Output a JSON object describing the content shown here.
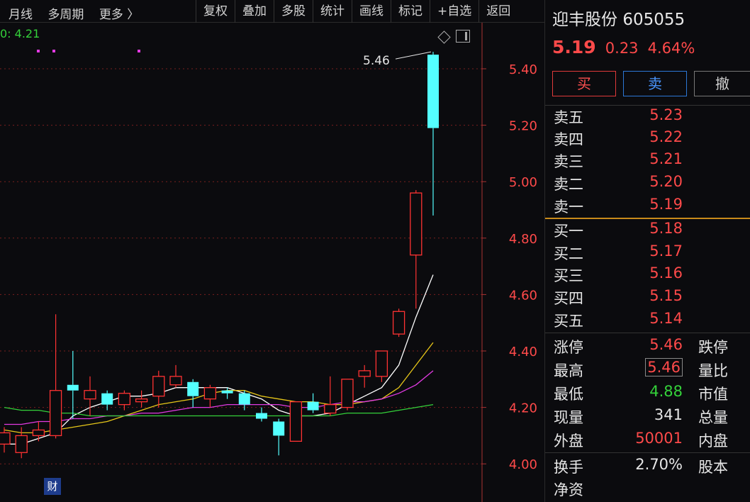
{
  "toolbar": {
    "left": [
      "月线",
      "多周期",
      "更多 〉"
    ],
    "right": [
      "复权",
      "叠加",
      "多股",
      "统计",
      "画线",
      "标记",
      "+自选",
      "返回"
    ]
  },
  "chart": {
    "ma_label": "0: 4.21",
    "high_label": "5.46",
    "cai_badge": "财",
    "y_ticks": [
      "5.40",
      "5.20",
      "5.00",
      "4.80",
      "4.60",
      "4.40",
      "4.20",
      "4.00"
    ],
    "up_color": "#ff3232",
    "down_color": "#54ffff"
  },
  "chart_data": {
    "type": "candlestick",
    "y_ticks": [
      5.4,
      5.2,
      5.0,
      4.8,
      4.6,
      4.4,
      4.2,
      4.0
    ],
    "candles": [
      {
        "o": 4.07,
        "c": 4.11,
        "h": 4.13,
        "l": 4.04
      },
      {
        "o": 4.04,
        "c": 4.1,
        "h": 4.13,
        "l": 4.02
      },
      {
        "o": 4.1,
        "c": 4.12,
        "h": 4.15,
        "l": 4.08
      },
      {
        "o": 4.1,
        "c": 4.26,
        "h": 4.53,
        "l": 4.09
      },
      {
        "o": 4.28,
        "c": 4.26,
        "h": 4.4,
        "l": 4.16
      },
      {
        "o": 4.23,
        "c": 4.26,
        "h": 4.31,
        "l": 4.17
      },
      {
        "o": 4.25,
        "c": 4.21,
        "h": 4.26,
        "l": 4.19
      },
      {
        "o": 4.21,
        "c": 4.25,
        "h": 4.26,
        "l": 4.19
      },
      {
        "o": 4.22,
        "c": 4.23,
        "h": 4.26,
        "l": 4.2
      },
      {
        "o": 4.24,
        "c": 4.31,
        "h": 4.33,
        "l": 4.2
      },
      {
        "o": 4.28,
        "c": 4.31,
        "h": 4.35,
        "l": 4.27
      },
      {
        "o": 4.29,
        "c": 4.24,
        "h": 4.3,
        "l": 4.2
      },
      {
        "o": 4.23,
        "c": 4.27,
        "h": 4.28,
        "l": 4.2
      },
      {
        "o": 4.26,
        "c": 4.25,
        "h": 4.27,
        "l": 4.23
      },
      {
        "o": 4.25,
        "c": 4.21,
        "h": 4.26,
        "l": 4.19
      },
      {
        "o": 4.18,
        "c": 4.16,
        "h": 4.2,
        "l": 4.15
      },
      {
        "o": 4.15,
        "c": 4.1,
        "h": 4.16,
        "l": 4.03
      },
      {
        "o": 4.08,
        "c": 4.22,
        "h": 4.22,
        "l": 4.08
      },
      {
        "o": 4.22,
        "c": 4.19,
        "h": 4.25,
        "l": 4.18
      },
      {
        "o": 4.18,
        "c": 4.21,
        "h": 4.31,
        "l": 4.17
      },
      {
        "o": 4.2,
        "c": 4.3,
        "h": 4.3,
        "l": 4.19
      },
      {
        "o": 4.31,
        "c": 4.33,
        "h": 4.35,
        "l": 4.27
      },
      {
        "o": 4.31,
        "c": 4.4,
        "h": 4.4,
        "l": 4.29
      },
      {
        "o": 4.46,
        "c": 4.54,
        "h": 4.55,
        "l": 4.45
      },
      {
        "o": 4.74,
        "c": 4.96,
        "h": 4.97,
        "l": 4.55
      },
      {
        "o": 5.45,
        "c": 5.19,
        "h": 5.46,
        "l": 4.88
      }
    ],
    "ma_lines": [
      {
        "color": "#ffffff",
        "values": [
          4.07,
          4.07,
          4.09,
          4.11,
          4.17,
          4.2,
          4.22,
          4.24,
          4.24,
          4.25,
          4.27,
          4.27,
          4.27,
          4.27,
          4.25,
          4.23,
          4.19,
          4.17,
          4.17,
          4.18,
          4.21,
          4.24,
          4.27,
          4.35,
          4.52,
          4.67
        ]
      },
      {
        "color": "#e6c619",
        "values": [
          4.12,
          4.11,
          4.11,
          4.12,
          4.13,
          4.14,
          4.15,
          4.17,
          4.19,
          4.21,
          4.22,
          4.23,
          4.25,
          4.26,
          4.26,
          4.24,
          4.23,
          4.22,
          4.22,
          4.21,
          4.21,
          4.22,
          4.23,
          4.27,
          4.35,
          4.43
        ]
      },
      {
        "color": "#e23ae2",
        "values": [
          4.14,
          4.14,
          4.15,
          4.15,
          4.16,
          4.16,
          4.17,
          4.17,
          4.18,
          4.18,
          4.19,
          4.2,
          4.2,
          4.21,
          4.21,
          4.21,
          4.21,
          4.2,
          4.2,
          4.21,
          4.22,
          4.22,
          4.23,
          4.25,
          4.28,
          4.33
        ]
      },
      {
        "color": "#34d13a",
        "values": [
          4.2,
          4.19,
          4.19,
          4.18,
          4.18,
          4.17,
          4.17,
          4.17,
          4.17,
          4.17,
          4.17,
          4.17,
          4.17,
          4.17,
          4.17,
          4.17,
          4.17,
          4.17,
          4.17,
          4.17,
          4.18,
          4.18,
          4.18,
          4.19,
          4.2,
          4.21
        ]
      }
    ]
  },
  "panel": {
    "stock_name": "迎丰股份",
    "stock_code": "605055",
    "price": "5.19",
    "change": "0.23",
    "change_pct": "4.64%",
    "buy_label": "买",
    "sell_label": "卖",
    "cancel_label": "撤",
    "asks": [
      {
        "label": "卖五",
        "price": "5.23"
      },
      {
        "label": "卖四",
        "price": "5.22"
      },
      {
        "label": "卖三",
        "price": "5.21"
      },
      {
        "label": "卖二",
        "price": "5.20"
      },
      {
        "label": "卖一",
        "price": "5.19"
      }
    ],
    "bids": [
      {
        "label": "买一",
        "price": "5.18"
      },
      {
        "label": "买二",
        "price": "5.17"
      },
      {
        "label": "买三",
        "price": "5.16"
      },
      {
        "label": "买四",
        "price": "5.15"
      },
      {
        "label": "买五",
        "price": "5.14"
      }
    ],
    "stats": [
      {
        "label": "涨停",
        "value": "5.46",
        "color": "#ff4a4a",
        "label2": "跌停"
      },
      {
        "label": "最高",
        "value": "5.46",
        "color": "#ff4a4a",
        "label2": "量比"
      },
      {
        "label": "最低",
        "value": "4.88",
        "color": "#34d13a",
        "label2": "市值"
      },
      {
        "label": "现量",
        "value": "341",
        "color": "#e6e6e6",
        "label2": "总量"
      },
      {
        "label": "外盘",
        "value": "50001",
        "color": "#ff4a4a",
        "label2": "内盘"
      },
      {
        "label": "换手",
        "value": "2.70%",
        "color": "#e6e6e6",
        "label2": "股本"
      },
      {
        "label": "净资",
        "value": "",
        "color": "#e6e6e6",
        "label2": ""
      }
    ]
  }
}
